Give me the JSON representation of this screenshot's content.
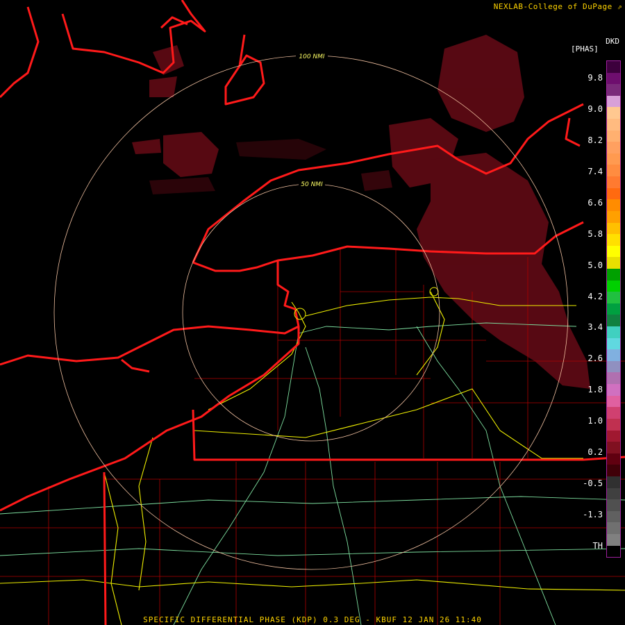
{
  "credit": "NEXLAB-College of DuPage",
  "product": "DKD",
  "units": "[PHAS]",
  "footer": "SPECIFIC DIFFERENTIAL PHASE (KDP) 0.3 DEG - KBUF 12 JAN 26 11:40",
  "range_rings": {
    "inner": "50 NMI",
    "outer": "100 NMI"
  },
  "legend": {
    "labels": [
      "9.8",
      "9.0",
      "8.2",
      "7.4",
      "6.6",
      "5.8",
      "5.0",
      "4.2",
      "3.4",
      "2.6",
      "1.8",
      "1.0",
      "0.2",
      "-0.5",
      "-1.3",
      "TH"
    ],
    "colors": [
      "#3c003c",
      "#6e0e6e",
      "#7a2a7a",
      "#d8a0d8",
      "#ffc890",
      "#ffbb80",
      "#ffb070",
      "#ffa060",
      "#ff9a50",
      "#ff8c40",
      "#ff7a30",
      "#ff6a10",
      "#ff8c00",
      "#ffa000",
      "#ffc000",
      "#ffe000",
      "#ffff00",
      "#e8e000",
      "#00a000",
      "#00d000",
      "#20c040",
      "#00a040",
      "#108040",
      "#40d0c0",
      "#60d8e0",
      "#80b0e0",
      "#9090c0",
      "#b070b0",
      "#d070c0",
      "#e060a0",
      "#d04070",
      "#c03050",
      "#a01830",
      "#801020",
      "#600010",
      "#400008",
      "#303030",
      "#404040",
      "#505050",
      "#606060",
      "#707070",
      "#808080",
      "#000000"
    ]
  }
}
